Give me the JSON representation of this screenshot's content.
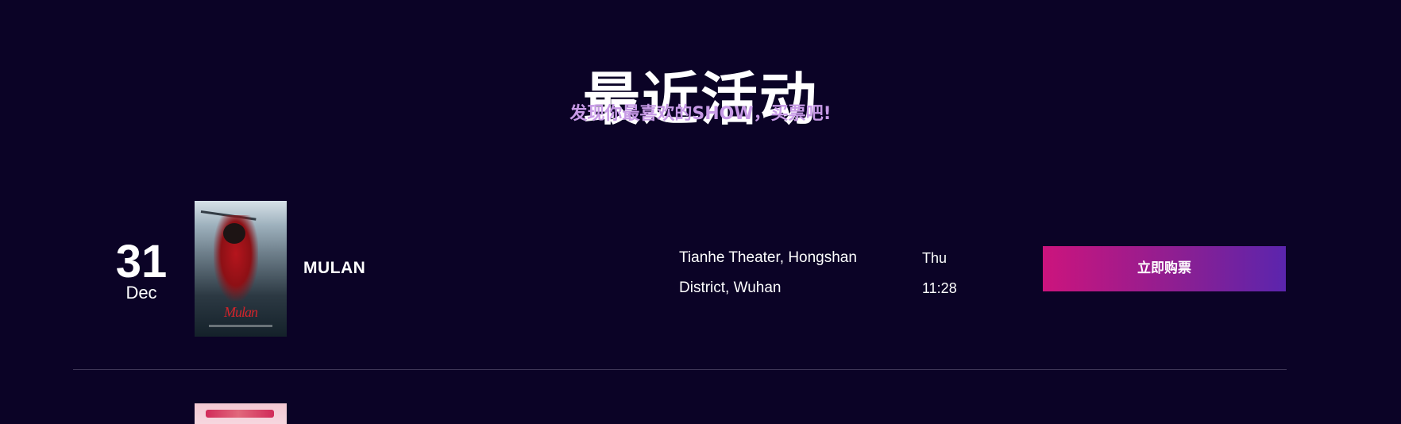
{
  "header": {
    "title": "最近活动",
    "subtitle": "发现你最喜欢的SHOW，买票吧!"
  },
  "events": [
    {
      "date": {
        "day": "31",
        "month": "Dec"
      },
      "poster": {
        "title": "Mulan"
      },
      "name": "MULAN",
      "venue": {
        "line1": "Tianhe Theater, Hongshan",
        "line2": "District, Wuhan"
      },
      "time": {
        "weekday": "Thu",
        "clock": "11:28"
      },
      "buy_label": "立即购票"
    }
  ],
  "colors": {
    "background": "#0b0326",
    "subtitle": "#c79ae6",
    "button_start": "#cc147d",
    "button_end": "#5b25ad",
    "divider": "#403858"
  }
}
